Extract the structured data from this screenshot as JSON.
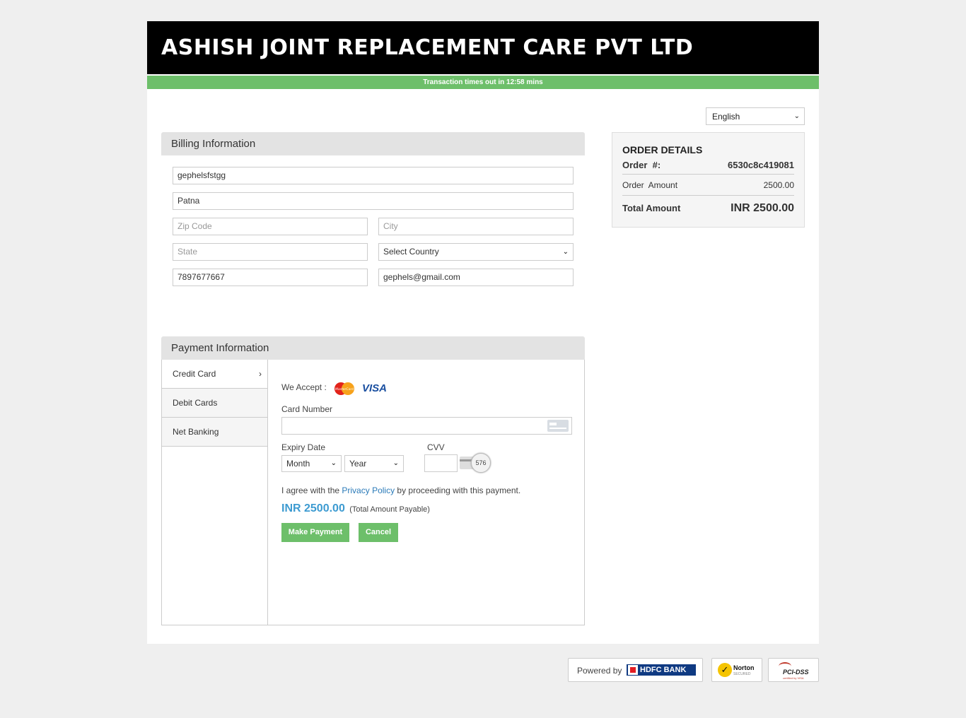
{
  "header": {
    "title": "ASHISH JOINT REPLACEMENT CARE PVT LTD"
  },
  "timer": {
    "prefix": "Transaction times out in ",
    "time": "12:58",
    "suffix": " mins"
  },
  "language": {
    "selected": "English"
  },
  "billing": {
    "title": "Billing Information",
    "name": "gephelsfstgg",
    "address": "Patna",
    "zip_placeholder": "Zip Code",
    "city_placeholder": "City",
    "state_placeholder": "State",
    "country": "Select Country",
    "phone": "7897677667",
    "email": "gephels@gmail.com"
  },
  "order": {
    "title": "ORDER DETAILS",
    "order_no_label": "Order  #:",
    "order_no": "6530c8c419081",
    "amount_label": "Order  Amount",
    "amount": "2500.00",
    "total_label": "Total Amount",
    "total": "INR 2500.00"
  },
  "payment": {
    "title": "Payment Information",
    "tabs": [
      {
        "label": "Credit Card"
      },
      {
        "label": "Debit Cards"
      },
      {
        "label": "Net Banking"
      }
    ],
    "we_accept": "We Accept :",
    "card_number_label": "Card Number",
    "expiry_label": "Expiry Date",
    "month": "Month",
    "year": "Year",
    "cvv_label": "CVV",
    "cvv_hint": "576",
    "agree_pre": "I agree with the ",
    "privacy_link": "Privacy Policy",
    "agree_post": " by proceeding with this payment.",
    "amount": "INR 2500.00",
    "amount_note": "(Total Amount Payable)",
    "make_payment": "Make Payment",
    "cancel": "Cancel",
    "visa": "VISA",
    "mastercard": "MasterCard"
  },
  "footer": {
    "powered_by": "Powered by",
    "bank": "HDFC BANK",
    "norton": "Norton",
    "norton_sub": "SECURED",
    "pci": "PCI-DSS",
    "pci_sub": "certified by VISA"
  },
  "colors": {
    "accent_green": "#6dbf6a",
    "link_blue": "#2a7ab8",
    "header_bg": "#000000"
  }
}
